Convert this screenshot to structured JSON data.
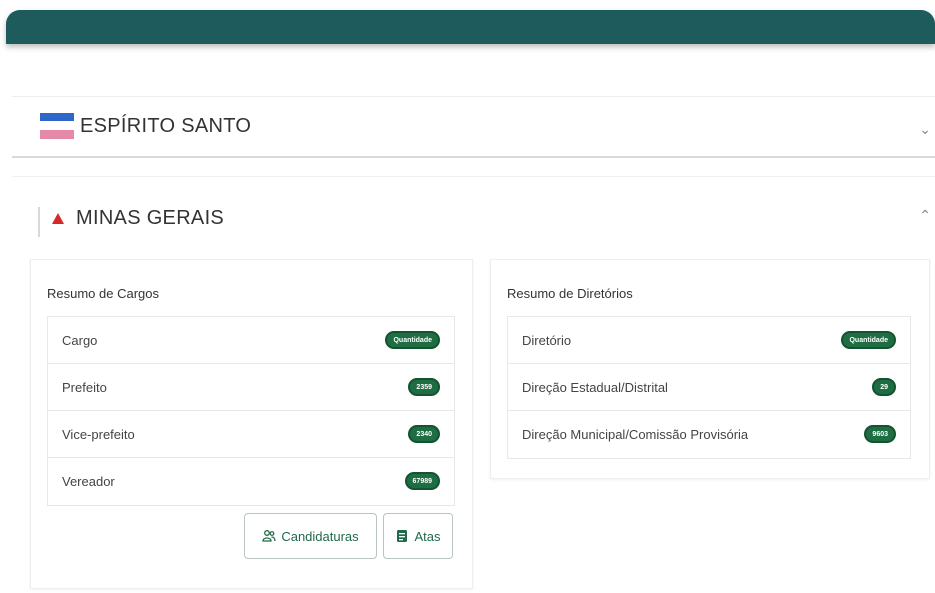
{
  "states": {
    "es": {
      "name": "ESPÍRITO SANTO",
      "chevron": "chevron-down-icon",
      "flag_colors": [
        "#2f66c9",
        "#ffffff",
        "#e48aa8"
      ]
    },
    "mg": {
      "name": "MINAS GERAIS",
      "chevron": "chevron-up-icon",
      "flag_mark_color": "#d62828"
    }
  },
  "cargos": {
    "title": "Resumo de Cargos",
    "header": {
      "label": "Cargo",
      "badge": "Quantidade"
    },
    "rows": [
      {
        "label": "Prefeito",
        "value": "2359"
      },
      {
        "label": "Vice-prefeito",
        "value": "2340"
      },
      {
        "label": "Vereador",
        "value": "67989"
      }
    ],
    "buttons": {
      "candidaturas": "Candidaturas",
      "atas": "Atas"
    }
  },
  "diretorios": {
    "title": "Resumo de Diretórios",
    "header": {
      "label": "Diretório",
      "badge": "Quantidade"
    },
    "rows": [
      {
        "label": "Direção Estadual/Distrital",
        "value": "29"
      },
      {
        "label": "Direção Municipal/Comissão Provisória",
        "value": "9603"
      }
    ]
  },
  "colors": {
    "topbar": "#1d5b5c",
    "badge": "#1e6d43",
    "button_text": "#1f6a4b"
  }
}
